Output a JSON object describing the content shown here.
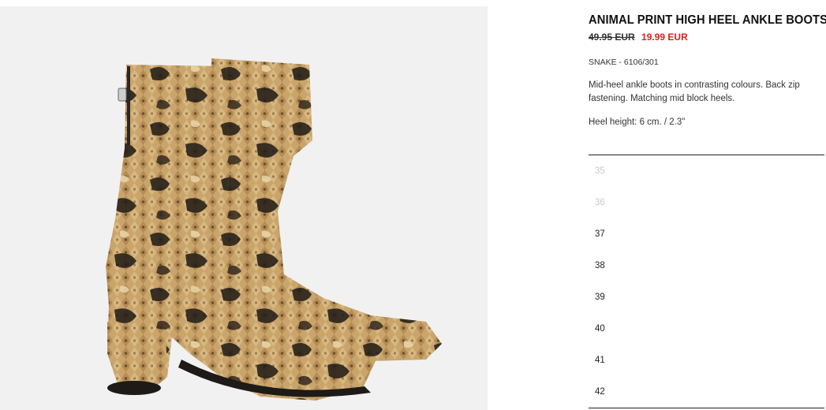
{
  "product": {
    "title": "ANIMAL PRINT HIGH HEEL ANKLE BOOTS",
    "old_price": "49.95 EUR",
    "new_price": "19.99 EUR",
    "reference": "SNAKE - 6106/301",
    "description": "Mid-heel ankle boots in contrasting colours. Back zip fastening. Matching mid block heels.",
    "heel_height": "Heel height: 6 cm. / 2.3\""
  },
  "sizes": [
    {
      "label": "35",
      "available": false
    },
    {
      "label": "36",
      "available": false
    },
    {
      "label": "37",
      "available": true
    },
    {
      "label": "38",
      "available": true
    },
    {
      "label": "39",
      "available": true
    },
    {
      "label": "40",
      "available": true
    },
    {
      "label": "41",
      "available": true
    },
    {
      "label": "42",
      "available": true
    }
  ],
  "colors": {
    "sale_price": "#e0201b",
    "image_background": "#f1f1f1"
  }
}
